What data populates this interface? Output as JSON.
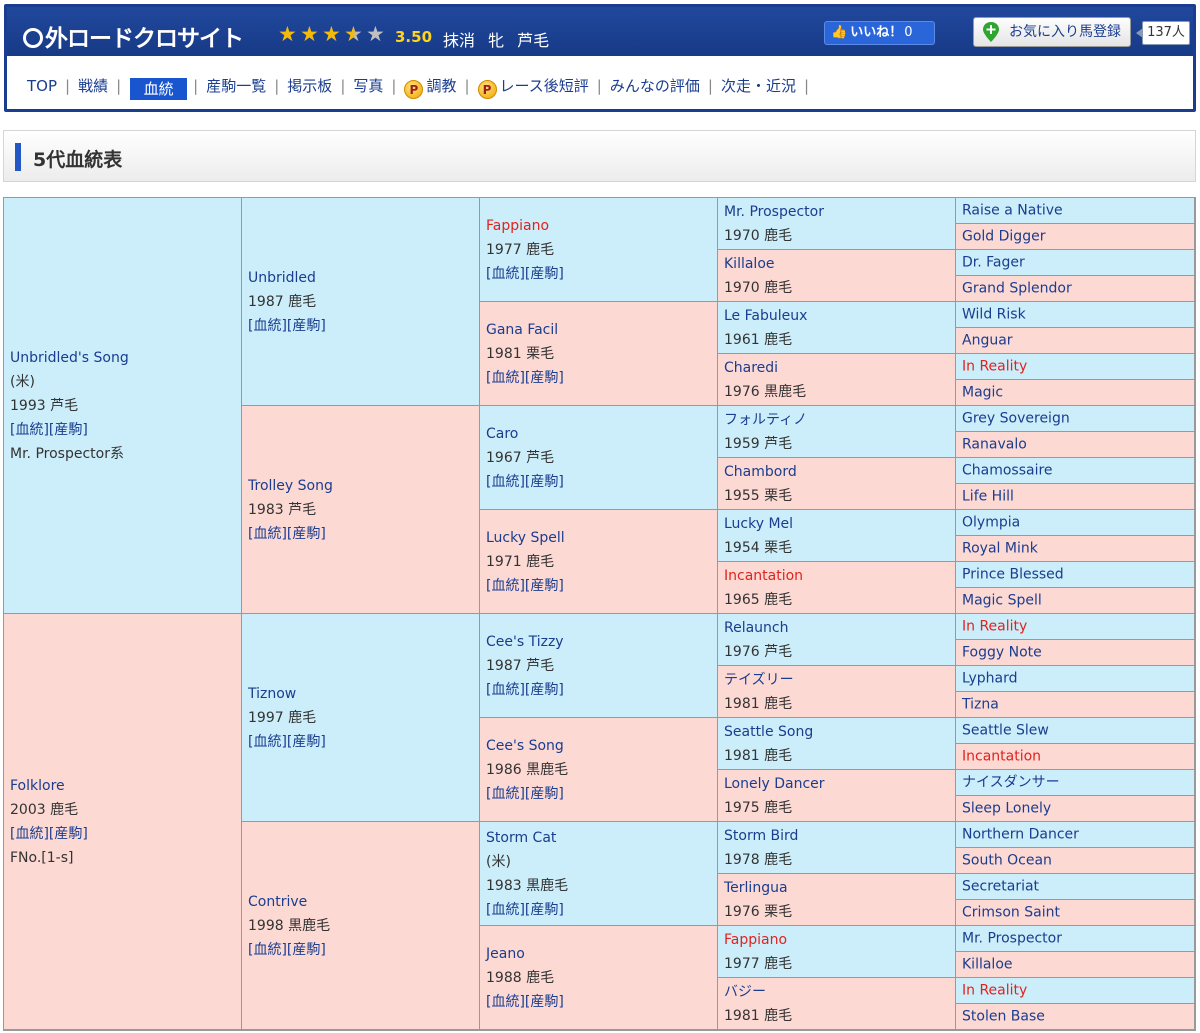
{
  "site": {
    "title": "外ロードクロサイト",
    "rating": "3.50",
    "stars": [
      "full",
      "full",
      "full",
      "half",
      "empty"
    ],
    "status": "抹消 牝 芦毛",
    "like_label": "いいね！",
    "like_count": "0",
    "fav_label": "お気に入り馬登録",
    "fav_count": "137人"
  },
  "nav": [
    {
      "label": "TOP"
    },
    {
      "label": "戦績"
    },
    {
      "label": "血統",
      "active": true
    },
    {
      "label": "産駒一覧"
    },
    {
      "label": "掲示板"
    },
    {
      "label": "写真"
    },
    {
      "label": "調教",
      "premium": true
    },
    {
      "label": "レース後短評",
      "premium": true
    },
    {
      "label": "みんなの評価"
    },
    {
      "label": "次走・近況"
    }
  ],
  "premium_mark": "P",
  "section_title": "5代血統表",
  "pedigree": {
    "g1": [
      {
        "name": "Unbridled's Song",
        "country": "(米)",
        "info": "1993 芦毛",
        "links": "[血統][産駒]",
        "extra": "Mr. Prospector系",
        "sex": "male"
      },
      {
        "name": "Folklore",
        "info": "2003 鹿毛",
        "links": "[血統][産駒]",
        "extra": "FNo.[1-s]",
        "sex": "female"
      }
    ],
    "g2": [
      {
        "name": "Unbridled",
        "info": "1987 鹿毛",
        "links": "[血統][産駒]",
        "sex": "male"
      },
      {
        "name": "Trolley Song",
        "info": "1983 芦毛",
        "links": "[血統][産駒]",
        "sex": "female"
      },
      {
        "name": "Tiznow",
        "info": "1997 鹿毛",
        "links": "[血統][産駒]",
        "sex": "male"
      },
      {
        "name": "Contrive",
        "info": "1998 黒鹿毛",
        "links": "[血統][産駒]",
        "sex": "female"
      }
    ],
    "g3": [
      {
        "name": "Fappiano",
        "info": "1977 鹿毛",
        "links": "[血統][産駒]",
        "sex": "male",
        "red": true
      },
      {
        "name": "Gana Facil",
        "info": "1981 栗毛",
        "links": "[血統][産駒]",
        "sex": "female"
      },
      {
        "name": "Caro",
        "info": "1967 芦毛",
        "links": "[血統][産駒]",
        "sex": "male"
      },
      {
        "name": "Lucky Spell",
        "info": "1971 鹿毛",
        "links": "[血統][産駒]",
        "sex": "female"
      },
      {
        "name": "Cee's Tizzy",
        "info": "1987 芦毛",
        "links": "[血統][産駒]",
        "sex": "male"
      },
      {
        "name": "Cee's Song",
        "info": "1986 黒鹿毛",
        "links": "[血統][産駒]",
        "sex": "female"
      },
      {
        "name": "Storm Cat",
        "country": "(米)",
        "info": "1983 黒鹿毛",
        "links": "[血統][産駒]",
        "sex": "male"
      },
      {
        "name": "Jeano",
        "info": "1988 鹿毛",
        "links": "[血統][産駒]",
        "sex": "female"
      }
    ],
    "g4": [
      {
        "name": "Mr. Prospector",
        "info": "1970 鹿毛",
        "sex": "male"
      },
      {
        "name": "Killaloe",
        "info": "1970 鹿毛",
        "sex": "female"
      },
      {
        "name": "Le Fabuleux",
        "info": "1961 鹿毛",
        "sex": "male"
      },
      {
        "name": "Charedi",
        "info": "1976 黒鹿毛",
        "sex": "female"
      },
      {
        "name": "フォルティノ",
        "info": "1959 芦毛",
        "sex": "male"
      },
      {
        "name": "Chambord",
        "info": "1955 栗毛",
        "sex": "female"
      },
      {
        "name": "Lucky Mel",
        "info": "1954 栗毛",
        "sex": "male"
      },
      {
        "name": "Incantation",
        "info": "1965 鹿毛",
        "sex": "female",
        "red": true
      },
      {
        "name": "Relaunch",
        "info": "1976 芦毛",
        "sex": "male"
      },
      {
        "name": "テイズリー",
        "info": "1981 鹿毛",
        "sex": "female"
      },
      {
        "name": "Seattle Song",
        "info": "1981 鹿毛",
        "sex": "male"
      },
      {
        "name": "Lonely Dancer",
        "info": "1975 鹿毛",
        "sex": "female"
      },
      {
        "name": "Storm Bird",
        "info": "1978 鹿毛",
        "sex": "male"
      },
      {
        "name": "Terlingua",
        "info": "1976 栗毛",
        "sex": "female"
      },
      {
        "name": "Fappiano",
        "info": "1977 鹿毛",
        "sex": "male",
        "red": true
      },
      {
        "name": "バジー",
        "info": "1981 鹿毛",
        "sex": "female"
      }
    ],
    "g5": [
      {
        "name": "Raise a Native",
        "sex": "male"
      },
      {
        "name": "Gold Digger",
        "sex": "female"
      },
      {
        "name": "Dr. Fager",
        "sex": "male"
      },
      {
        "name": "Grand Splendor",
        "sex": "female"
      },
      {
        "name": "Wild Risk",
        "sex": "male"
      },
      {
        "name": "Anguar",
        "sex": "female"
      },
      {
        "name": "In Reality",
        "sex": "male",
        "red": true
      },
      {
        "name": "Magic",
        "sex": "female"
      },
      {
        "name": "Grey Sovereign",
        "sex": "male"
      },
      {
        "name": "Ranavalo",
        "sex": "female"
      },
      {
        "name": "Chamossaire",
        "sex": "male"
      },
      {
        "name": "Life Hill",
        "sex": "female"
      },
      {
        "name": "Olympia",
        "sex": "male"
      },
      {
        "name": "Royal Mink",
        "sex": "female"
      },
      {
        "name": "Prince Blessed",
        "sex": "male"
      },
      {
        "name": "Magic Spell",
        "sex": "female"
      },
      {
        "name": "In Reality",
        "sex": "male",
        "red": true
      },
      {
        "name": "Foggy Note",
        "sex": "female"
      },
      {
        "name": "Lyphard",
        "sex": "male"
      },
      {
        "name": "Tizna",
        "sex": "female"
      },
      {
        "name": "Seattle Slew",
        "sex": "male"
      },
      {
        "name": "Incantation",
        "sex": "female",
        "red": true
      },
      {
        "name": "ナイスダンサー",
        "sex": "male"
      },
      {
        "name": "Sleep Lonely",
        "sex": "female"
      },
      {
        "name": "Northern Dancer",
        "sex": "male"
      },
      {
        "name": "South Ocean",
        "sex": "female"
      },
      {
        "name": "Secretariat",
        "sex": "male"
      },
      {
        "name": "Crimson Saint",
        "sex": "female"
      },
      {
        "name": "Mr. Prospector",
        "sex": "male"
      },
      {
        "name": "Killaloe",
        "sex": "female"
      },
      {
        "name": "In Reality",
        "sex": "male",
        "red": true
      },
      {
        "name": "Stolen Base",
        "sex": "female"
      }
    ]
  }
}
